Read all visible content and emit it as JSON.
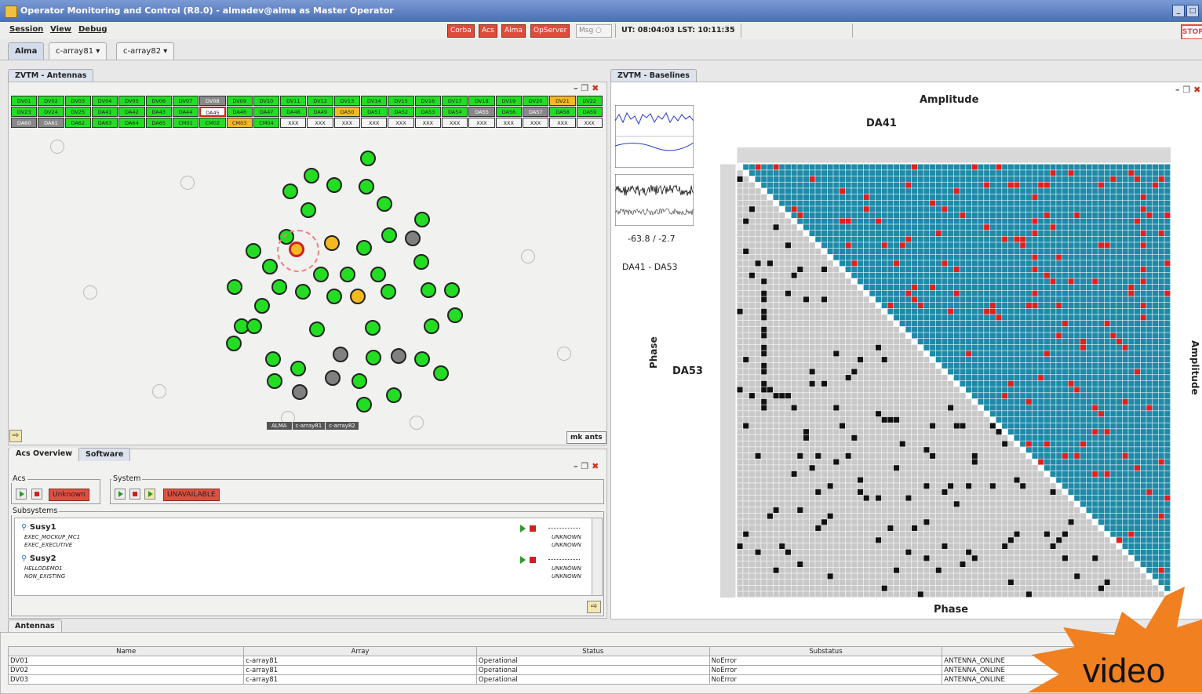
{
  "window": {
    "title": "Operator Monitoring and Control (R8.0) - almadev@alma as Master Operator"
  },
  "menu": {
    "session": "Session",
    "view": "View",
    "debug": "Debug"
  },
  "status": {
    "corba": "Corba",
    "acs": "Acs",
    "alma": "Alma",
    "opserver": "OpServer",
    "msg": "Msg",
    "ut_lst": "UT: 08:04:03  LST: 10:11:35",
    "stop": "STOP"
  },
  "tabs": {
    "alma": "Alma",
    "c_array81": "c-array81 ▾",
    "c_array82": "c-array82 ▾"
  },
  "antennas_panel": {
    "tab": "ZVTM - Antennas",
    "rows": [
      [
        [
          "DV01",
          "g"
        ],
        [
          "DV02",
          "g"
        ],
        [
          "DV03",
          "g"
        ],
        [
          "DV04",
          "g"
        ],
        [
          "DV05",
          "g"
        ],
        [
          "DV06",
          "g"
        ],
        [
          "DV07",
          "g"
        ],
        [
          "DV08",
          "gr"
        ],
        [
          "DV09",
          "g"
        ],
        [
          "DV10",
          "g"
        ],
        [
          "DV11",
          "g"
        ],
        [
          "DV12",
          "g"
        ],
        [
          "DV13",
          "g"
        ],
        [
          "DV14",
          "g"
        ],
        [
          "DV15",
          "g"
        ],
        [
          "DV16",
          "g"
        ],
        [
          "DV17",
          "g"
        ],
        [
          "DV18",
          "g"
        ],
        [
          "DV19",
          "g"
        ],
        [
          "DV20",
          "g"
        ],
        [
          "DV21",
          "y"
        ],
        [
          "DV22",
          "g"
        ]
      ],
      [
        [
          "DV23",
          "g"
        ],
        [
          "DV24",
          "g"
        ],
        [
          "DV25",
          "g"
        ],
        [
          "DA41",
          "g"
        ],
        [
          "DA42",
          "g"
        ],
        [
          "DA43",
          "g"
        ],
        [
          "DA44",
          "g"
        ],
        [
          "DA45",
          "sel"
        ],
        [
          "DA46",
          "g"
        ],
        [
          "DA47",
          "g"
        ],
        [
          "DA48",
          "g"
        ],
        [
          "DA49",
          "g"
        ],
        [
          "DA50",
          "y"
        ],
        [
          "DA51",
          "g"
        ],
        [
          "DA52",
          "g"
        ],
        [
          "DA53",
          "g"
        ],
        [
          "DA54",
          "g"
        ],
        [
          "DA55",
          "gr"
        ],
        [
          "DA56",
          "g"
        ],
        [
          "DA57",
          "gr"
        ],
        [
          "DA58",
          "g"
        ],
        [
          "DA59",
          "g"
        ]
      ],
      [
        [
          "DA60",
          "gr"
        ],
        [
          "DA61",
          "gr"
        ],
        [
          "DA62",
          "g"
        ],
        [
          "DA63",
          "g"
        ],
        [
          "DA64",
          "g"
        ],
        [
          "DA65",
          "g"
        ],
        [
          "CM01",
          "g"
        ],
        [
          "CM02",
          "g"
        ],
        [
          "CM03",
          "y"
        ],
        [
          "CM04",
          "g"
        ],
        [
          "XXX",
          "x"
        ],
        [
          "XXX",
          "x"
        ],
        [
          "XXX",
          "x"
        ],
        [
          "XXX",
          "x"
        ],
        [
          "XXX",
          "x"
        ],
        [
          "XXX",
          "x"
        ],
        [
          "XXX",
          "x"
        ],
        [
          "XXX",
          "x"
        ],
        [
          "XXX",
          "x"
        ],
        [
          "XXX",
          "x"
        ],
        [
          "XXX",
          "x"
        ],
        [
          "XXX",
          "x"
        ]
      ]
    ],
    "map_legend": [
      "ALMA",
      "c-array81",
      "c-array82"
    ],
    "mk_ants": "mk ants"
  },
  "software_panel": {
    "tabs": [
      "Acs Overview",
      "Software"
    ],
    "acs_label": "Acs",
    "acs_state": "Unknown",
    "system_label": "System",
    "system_state": "UNAVAILABLE",
    "subsystems_label": "Subsystems",
    "subsystems": [
      {
        "name": "Susy1",
        "items": [
          {
            "name": "EXEC_MOCKUP_MC1",
            "state": "UNKNOWN"
          },
          {
            "name": "EXEC_EXECUTIVE",
            "state": "UNKNOWN"
          }
        ]
      },
      {
        "name": "Susy2",
        "items": [
          {
            "name": "HELLODEMO1",
            "state": "UNKNOWN"
          },
          {
            "name": "NON_EXISTING",
            "state": "UNKNOWN"
          }
        ]
      }
    ]
  },
  "baselines_panel": {
    "tab": "ZVTM - Baselines",
    "amplitude_top": "Amplitude",
    "amplitude_right": "Amplitude",
    "phase_bottom": "Phase",
    "phase_left": "Phase",
    "col_antenna": "DA41",
    "row_antenna": "DA53",
    "readout": "-63.8 / -2.7",
    "pair": "DA41 - DA53"
  },
  "antennas_table": {
    "tab": "Antennas",
    "columns": [
      "Name",
      "Array",
      "Status",
      "Substatus",
      ""
    ],
    "rows": [
      [
        "DV01",
        "c-array81",
        "Operational",
        "NoError",
        "ANTENNA_ONLINE"
      ],
      [
        "DV02",
        "c-array81",
        "Operational",
        "NoError",
        "ANTENNA_ONLINE"
      ],
      [
        "DV03",
        "c-array81",
        "Operational",
        "NoError",
        "ANTENNA_ONLINE"
      ]
    ]
  },
  "overlay": {
    "text": "video",
    "color": "#f08020"
  }
}
